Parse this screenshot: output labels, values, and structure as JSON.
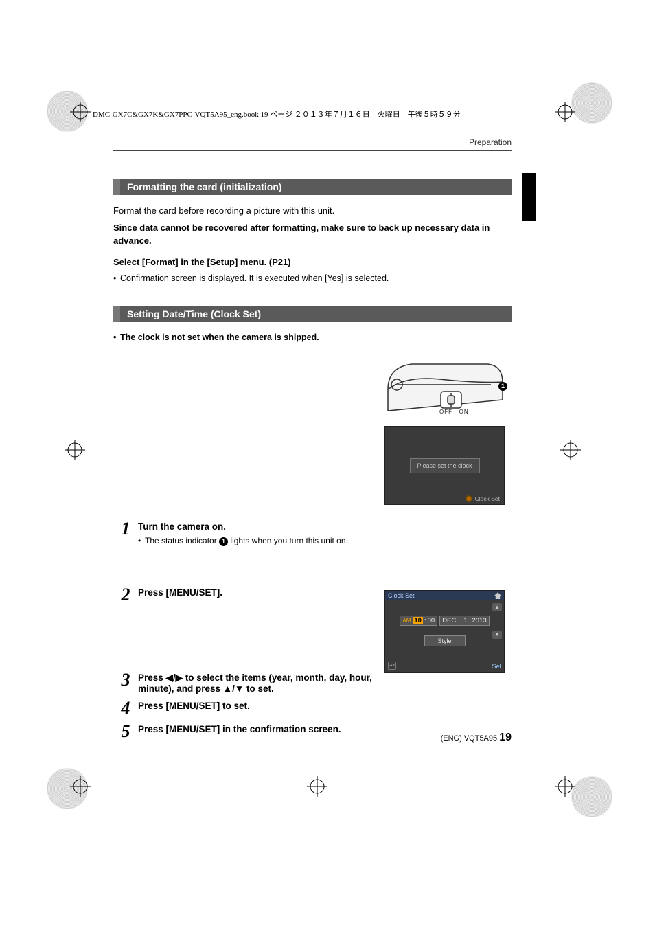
{
  "crop_header": "DMC-GX7C&GX7K&GX7PPC-VQT5A95_eng.book  19 ページ  ２０１３年７月１６日　火曜日　午後５時５９分",
  "breadcrumb": "Preparation",
  "section1": {
    "title": "Formatting the card (initialization)",
    "p1": "Format the card before recording a picture with this unit.",
    "p2": "Since data cannot be recovered after formatting, make sure to back up necessary data in advance.",
    "p3": "Select [Format] in the [Setup] menu. (P21)",
    "b1": "Confirmation screen is displayed. It is executed when [Yes] is selected."
  },
  "section2": {
    "title": "Setting Date/Time (Clock Set)",
    "b1": "The clock is not set when the camera is shipped.",
    "steps": [
      {
        "n": "1",
        "title": "Turn the camera on.",
        "sub_pre": "The status indicator ",
        "sub_post": " lights when you turn this unit on."
      },
      {
        "n": "2",
        "title": "Press [MENU/SET]."
      },
      {
        "n": "3",
        "title_pre": "Press ",
        "arrows1": "◀/▶",
        "title_mid": " to select the items (year, month, day, hour, minute), and press ",
        "arrows2": "▲/▼",
        "title_post": " to set."
      },
      {
        "n": "4",
        "title": "Press [MENU/SET] to set."
      },
      {
        "n": "5",
        "title": "Press [MENU/SET] in the confirmation screen."
      }
    ],
    "camera_fig": {
      "off": "OFF",
      "on": "ON",
      "callout": "1"
    },
    "screen_clock_prompt": {
      "message": "Please set the clock",
      "footer": "Clock Set"
    },
    "screen_clock_set": {
      "title": "Clock Set",
      "ampm": "AM",
      "hour": "10",
      "colon": ":",
      "minute": "00",
      "month": "DEC",
      "sep": ".",
      "day": "1",
      "sep2": ".",
      "year": "2013",
      "style": "Style",
      "back": "↶",
      "set": "Set",
      "up": "▲",
      "down": "▼"
    }
  },
  "footer": {
    "lang": "(ENG)",
    "code": "VQT5A95",
    "page": "19"
  }
}
